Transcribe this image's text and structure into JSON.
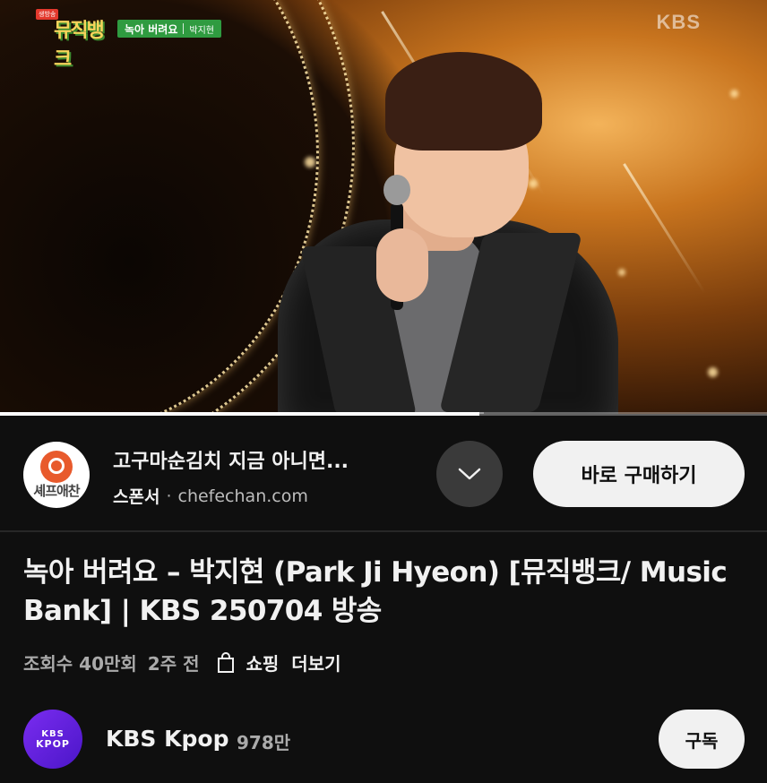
{
  "video": {
    "broadcast_logo": "뮤직뱅크",
    "live_badge": "생방송",
    "caption_song": "녹아 버려요",
    "caption_artist": "박지현",
    "network_watermark": "KBS",
    "progress_fraction": 0.625
  },
  "sponsor": {
    "logo_text": "셰프애찬",
    "title": "고구마순김치 지금 아니면...",
    "label": "스폰서",
    "separator": "·",
    "domain": "chefechan.com",
    "expand_icon": "chevron-down-icon",
    "cta_label": "바로 구매하기"
  },
  "details": {
    "title": "녹아 버려요 – 박지현 (Park Ji Hyeon) [뮤직뱅크/ Music Bank] | KBS 250704 방송",
    "views": "조회수 40만회",
    "age": "2주 전",
    "shopping_icon": "shopping-bag-icon",
    "shopping_label": "쇼핑",
    "more_label": "더보기"
  },
  "channel": {
    "avatar_line1": "KBS",
    "avatar_line2": "KPOP",
    "name": "KBS Kpop",
    "subscribers": "978만",
    "subscribe_label": "구독"
  },
  "colors": {
    "background": "#0f0f0f",
    "primary_text": "#f1f1f1",
    "secondary_text": "#aaaaaa",
    "button_light": "#f1f1f1",
    "button_dark": "#3a3a3a",
    "sponsor_brand": "#e85a2c",
    "channel_avatar": "#6a22e6",
    "caption_green": "#2f9b40"
  }
}
